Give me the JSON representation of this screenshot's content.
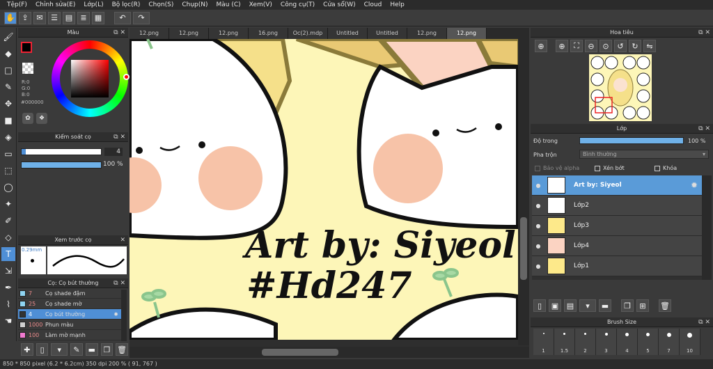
{
  "menu": [
    "Tệp(F)",
    "Chỉnh sửa(E)",
    "Lớp(L)",
    "Bộ lọc(R)",
    "Chọn(S)",
    "Chụp(N)",
    "Màu (C)",
    "Xem(V)",
    "Công cụ(T)",
    "Cửa sổ(W)",
    "Cloud",
    "Help"
  ],
  "toolbar_icons": [
    "hand-icon",
    "export-icon",
    "chat-icon",
    "list-icon",
    "document-icon",
    "layers-icon",
    "grid-icon",
    "undo-icon",
    "redo-icon"
  ],
  "color_panel": {
    "title": "Màu",
    "rgb": [
      "R:0",
      "G:0",
      "B:0"
    ],
    "hex": "#000000",
    "fg": "#000000",
    "bg": "#ffffff"
  },
  "brush_control": {
    "title": "Kiểm soát cọ",
    "size": "4",
    "opacity": "100 %"
  },
  "brush_preview": {
    "title": "Xem trước cọ",
    "size": "0.29mm"
  },
  "brush_list": {
    "title": "Cọ: Cọ bút thường",
    "items": [
      {
        "size": "7",
        "name": "Cọ shade đậm",
        "color": "#8fd4f2"
      },
      {
        "size": "25",
        "name": "Cọ shade mờ",
        "color": "#8fd4f2"
      },
      {
        "size": "4",
        "name": "Cọ bút thường",
        "color": "#333333",
        "selected": true
      },
      {
        "size": "1000",
        "name": "Phun màu",
        "color": "#d0d0d0"
      },
      {
        "size": "100",
        "name": "Làm mờ mạnh",
        "color": "#f07ad0"
      }
    ]
  },
  "tabs": [
    "12.png",
    "12.png",
    "12.png",
    "16.png",
    "Oc(2).mdp",
    "Untitled",
    "Untitled",
    "12.png",
    "12.png"
  ],
  "active_tab": 8,
  "canvas": {
    "line1": "Art by: Siyeol",
    "line2": "#Hd247",
    "bg": "#fdf6b8"
  },
  "navigator": {
    "title": "Hoa tiêu"
  },
  "layers": {
    "title": "Lớp",
    "opacity_label": "Độ trong",
    "opacity_value": "100 %",
    "blend_label": "Pha trộn",
    "blend_value": "Bình thường",
    "alpha_label": "Bảo vệ alpha",
    "clip_label": "Xén bớt",
    "lock_label": "Khóa",
    "items": [
      "Art by: Siyeol",
      "Lớp2",
      "Lớp3",
      "Lớp4",
      "Lớp1"
    ]
  },
  "brush_size": {
    "title": "Brush Size",
    "labels": [
      "1",
      "1.5",
      "2",
      "3",
      "4",
      "5",
      "7",
      "10"
    ]
  },
  "status": {
    "text": "850 * 850 pixel  (6.2 * 6.2cm)  350 dpi  200 %  ( 91, 767 )"
  }
}
